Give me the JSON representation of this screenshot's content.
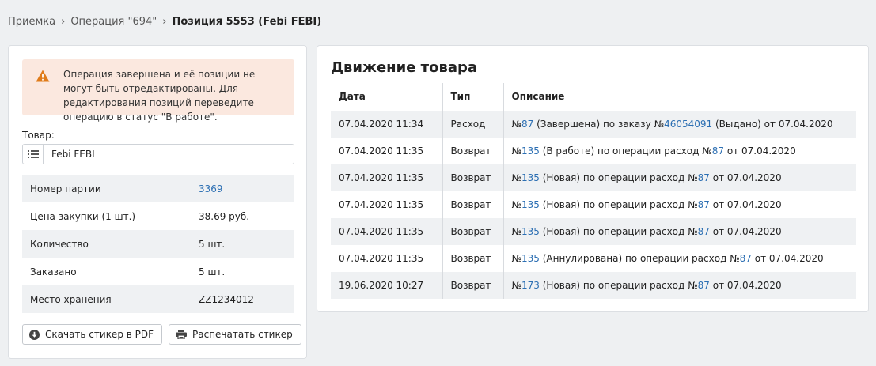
{
  "breadcrumb": {
    "items": [
      {
        "label": "Приемка"
      },
      {
        "label": "Операция \"694\""
      }
    ],
    "current": "Позиция 5553 (Febi FEBI)"
  },
  "left": {
    "alert_text": "Операция завершена и её позиции не могут быть отредактированы. Для редактирования позиций переведите операцию в статус \"В работе\".",
    "product_label": "Товар:",
    "product_value": "Febi FEBI",
    "props": [
      {
        "key": "Номер партии",
        "value": "3369",
        "is_link": true
      },
      {
        "key": "Цена закупки (1 шт.)",
        "value": "38.69 руб.",
        "is_link": false
      },
      {
        "key": "Количество",
        "value": "5 шт.",
        "is_link": false
      },
      {
        "key": "Заказано",
        "value": "5 шт.",
        "is_link": false
      },
      {
        "key": "Место хранения",
        "value": "ZZ1234012",
        "is_link": false
      }
    ],
    "download_button": "Скачать стикер в PDF",
    "print_button": "Распечатать стикер"
  },
  "movements": {
    "title": "Движение товара",
    "columns": [
      "Дата",
      "Тип",
      "Описание"
    ],
    "rows": [
      {
        "date": "07.04.2020 11:34",
        "type": "Расход",
        "desc": [
          {
            "t": "№"
          },
          {
            "t": "87",
            "link": true
          },
          {
            "t": " (Завершена) по заказу №"
          },
          {
            "t": "46054091",
            "link": true
          },
          {
            "t": " (Выдано) от 07.04.2020"
          }
        ]
      },
      {
        "date": "07.04.2020 11:35",
        "type": "Возврат",
        "desc": [
          {
            "t": "№"
          },
          {
            "t": "135",
            "link": true
          },
          {
            "t": " (В работе) по операции расход №"
          },
          {
            "t": "87",
            "link": true
          },
          {
            "t": " от 07.04.2020"
          }
        ]
      },
      {
        "date": "07.04.2020 11:35",
        "type": "Возврат",
        "desc": [
          {
            "t": "№"
          },
          {
            "t": "135",
            "link": true
          },
          {
            "t": " (Новая) по операции расход №"
          },
          {
            "t": "87",
            "link": true
          },
          {
            "t": " от 07.04.2020"
          }
        ]
      },
      {
        "date": "07.04.2020 11:35",
        "type": "Возврат",
        "desc": [
          {
            "t": "№"
          },
          {
            "t": "135",
            "link": true
          },
          {
            "t": " (Новая) по операции расход №"
          },
          {
            "t": "87",
            "link": true
          },
          {
            "t": " от 07.04.2020"
          }
        ]
      },
      {
        "date": "07.04.2020 11:35",
        "type": "Возврат",
        "desc": [
          {
            "t": "№"
          },
          {
            "t": "135",
            "link": true
          },
          {
            "t": " (Новая) по операции расход №"
          },
          {
            "t": "87",
            "link": true
          },
          {
            "t": " от 07.04.2020"
          }
        ]
      },
      {
        "date": "07.04.2020 11:35",
        "type": "Возврат",
        "desc": [
          {
            "t": "№"
          },
          {
            "t": "135",
            "link": true
          },
          {
            "t": " (Аннулирована) по операции расход №"
          },
          {
            "t": "87",
            "link": true
          },
          {
            "t": " от 07.04.2020"
          }
        ]
      },
      {
        "date": "19.06.2020 10:27",
        "type": "Возврат",
        "desc": [
          {
            "t": "№"
          },
          {
            "t": "173",
            "link": true
          },
          {
            "t": " (Новая) по операции расход №"
          },
          {
            "t": "87",
            "link": true
          },
          {
            "t": " от 07.04.2020"
          }
        ]
      }
    ]
  },
  "colors": {
    "link": "#2c6fb3",
    "alert_bg": "#fbe8df",
    "warning": "#e07b1a",
    "page_bg": "#eef0f2"
  },
  "icons": {
    "alert": "warning-triangle-icon",
    "product": "list-icon",
    "download": "download-circle-icon",
    "print": "printer-icon",
    "separator": "chevron-right-icon"
  }
}
